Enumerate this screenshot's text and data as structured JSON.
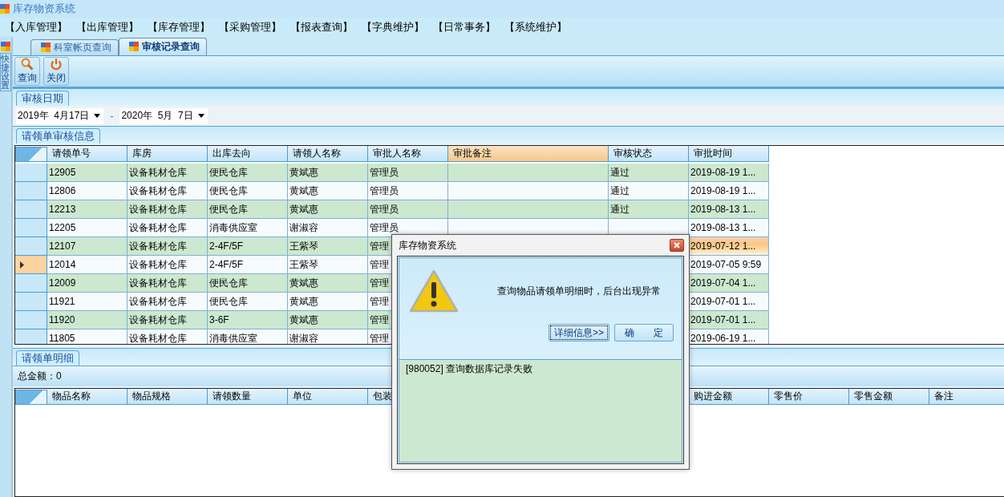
{
  "window": {
    "title": "库存物资系统"
  },
  "menu": [
    "【入库管理】",
    "【出库管理】",
    "【库存管理】",
    "【采购管理】",
    "【报表查询】",
    "【字典维护】",
    "【日常事务】",
    "【系统维护】"
  ],
  "side_tab": {
    "label": "快捷设置"
  },
  "tabs": [
    {
      "label": "科室帐页查询",
      "selected": false
    },
    {
      "label": "审核记录查询",
      "selected": true
    }
  ],
  "toolbar": [
    {
      "label": "查询",
      "kind": "search"
    },
    {
      "label": "关闭",
      "kind": "power"
    }
  ],
  "date_group": {
    "title": "审核日期",
    "from": "2019年  4月17日",
    "separator": "-",
    "to": "2020年  5月  7日"
  },
  "audit_group": {
    "title": "请领单审核信息",
    "columns": [
      {
        "label": "请领单号",
        "highlighted": false
      },
      {
        "label": "库房",
        "highlighted": false
      },
      {
        "label": "出库去向",
        "highlighted": false
      },
      {
        "label": "请领人名称",
        "highlighted": false
      },
      {
        "label": "审批人名称",
        "highlighted": false
      },
      {
        "label": "审批备注",
        "highlighted": true
      },
      {
        "label": "审核状态",
        "highlighted": false
      },
      {
        "label": "审批时间",
        "highlighted": false
      }
    ],
    "rows": [
      {
        "selected": false,
        "hot": false,
        "cells": [
          "12905",
          "设备耗材仓库",
          "便民仓库",
          "黄斌惠",
          "管理员",
          null,
          "通过",
          "2019-08-19 1..."
        ]
      },
      {
        "selected": false,
        "hot": false,
        "cells": [
          "12806",
          "设备耗材仓库",
          "便民仓库",
          "黄斌惠",
          "管理员",
          null,
          "通过",
          "2019-08-19 1..."
        ]
      },
      {
        "selected": false,
        "hot": false,
        "cells": [
          "12213",
          "设备耗材仓库",
          "便民仓库",
          "黄斌惠",
          "管理员",
          null,
          "通过",
          "2019-08-13 1..."
        ]
      },
      {
        "selected": false,
        "hot": false,
        "cells": [
          "12205",
          "设备耗材仓库",
          "消毒供应室",
          "谢淑容",
          "管理员",
          null,
          null,
          "2019-08-13 1..."
        ]
      },
      {
        "selected": false,
        "hot": true,
        "cells": [
          "12107",
          "设备耗材仓库",
          "2-4F/5F",
          "王紫琴",
          "管理",
          null,
          null,
          "2019-07-12 1..."
        ]
      },
      {
        "selected": true,
        "hot": false,
        "cells": [
          "12014",
          "设备耗材仓库",
          "2-4F/5F",
          "王紫琴",
          "管理",
          null,
          null,
          "2019-07-05 9:59"
        ]
      },
      {
        "selected": false,
        "hot": false,
        "cells": [
          "12009",
          "设备耗材仓库",
          "便民仓库",
          "黄斌惠",
          "管理",
          null,
          null,
          "2019-07-04 1..."
        ]
      },
      {
        "selected": false,
        "hot": false,
        "cells": [
          "11921",
          "设备耗材仓库",
          "便民仓库",
          "黄斌惠",
          "管理",
          null,
          null,
          "2019-07-01 1..."
        ]
      },
      {
        "selected": false,
        "hot": false,
        "cells": [
          "11920",
          "设备耗材仓库",
          "3-6F",
          "黄斌惠",
          "管理",
          null,
          null,
          "2019-07-01 1..."
        ]
      },
      {
        "selected": false,
        "hot": false,
        "cells": [
          "11805",
          "设备耗材仓库",
          "消毒供应室",
          "谢淑容",
          "管理",
          null,
          null,
          "2019-06-19 1..."
        ]
      }
    ]
  },
  "detail_group": {
    "title": "请领单明细",
    "total": "总金额：0",
    "columns": [
      "物品名称",
      "物品规格",
      "请领数量",
      "单位",
      "包装",
      "购进金额",
      "零售价",
      "零售金额",
      "备注"
    ]
  },
  "dialog": {
    "title": "库存物资系统",
    "message": "查询物品请领单明细时，后台出现异常",
    "buttons": [
      {
        "label": "详细信息>>",
        "focused": true
      },
      {
        "label": "确　　定",
        "focused": false
      }
    ],
    "detail": "[980052] 查询数据库记录失败"
  }
}
